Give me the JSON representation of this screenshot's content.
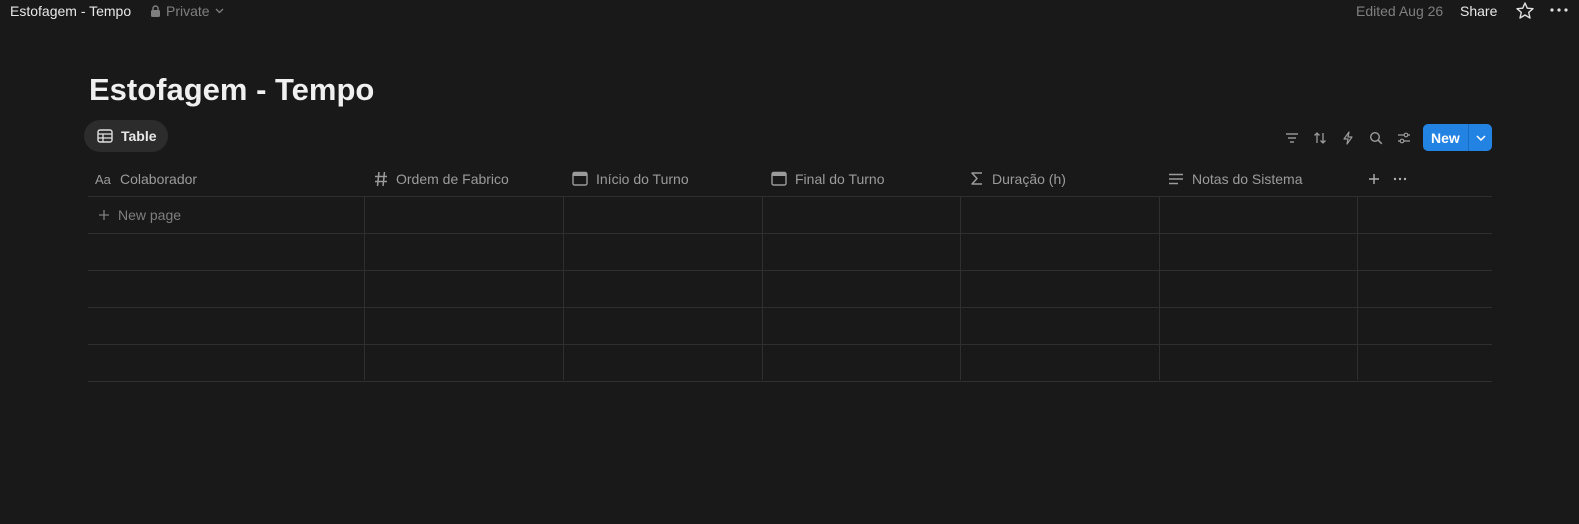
{
  "topbar": {
    "title": "Estofagem - Tempo",
    "privacy": "Private",
    "edited": "Edited Aug 26",
    "share": "Share"
  },
  "page": {
    "title": "Estofagem - Tempo"
  },
  "view": {
    "tab_label": "Table"
  },
  "toolbar": {
    "icons": [
      "filter-icon",
      "sort-icon",
      "automation-icon",
      "search-icon",
      "settings-icon"
    ],
    "new_label": "New"
  },
  "table": {
    "columns": [
      {
        "label": "Colaborador",
        "icon": "text-icon"
      },
      {
        "label": "Ordem de Fabrico",
        "icon": "number-icon"
      },
      {
        "label": "Início do Turno",
        "icon": "calendar-icon"
      },
      {
        "label": "Final do Turno",
        "icon": "calendar-icon"
      },
      {
        "label": "Duração (h)",
        "icon": "formula-icon"
      },
      {
        "label": "Notas do Sistema",
        "icon": "text-lines-icon"
      }
    ],
    "new_page_label": "New page"
  },
  "colors": {
    "background": "#191919",
    "accent": "#2383e2"
  }
}
